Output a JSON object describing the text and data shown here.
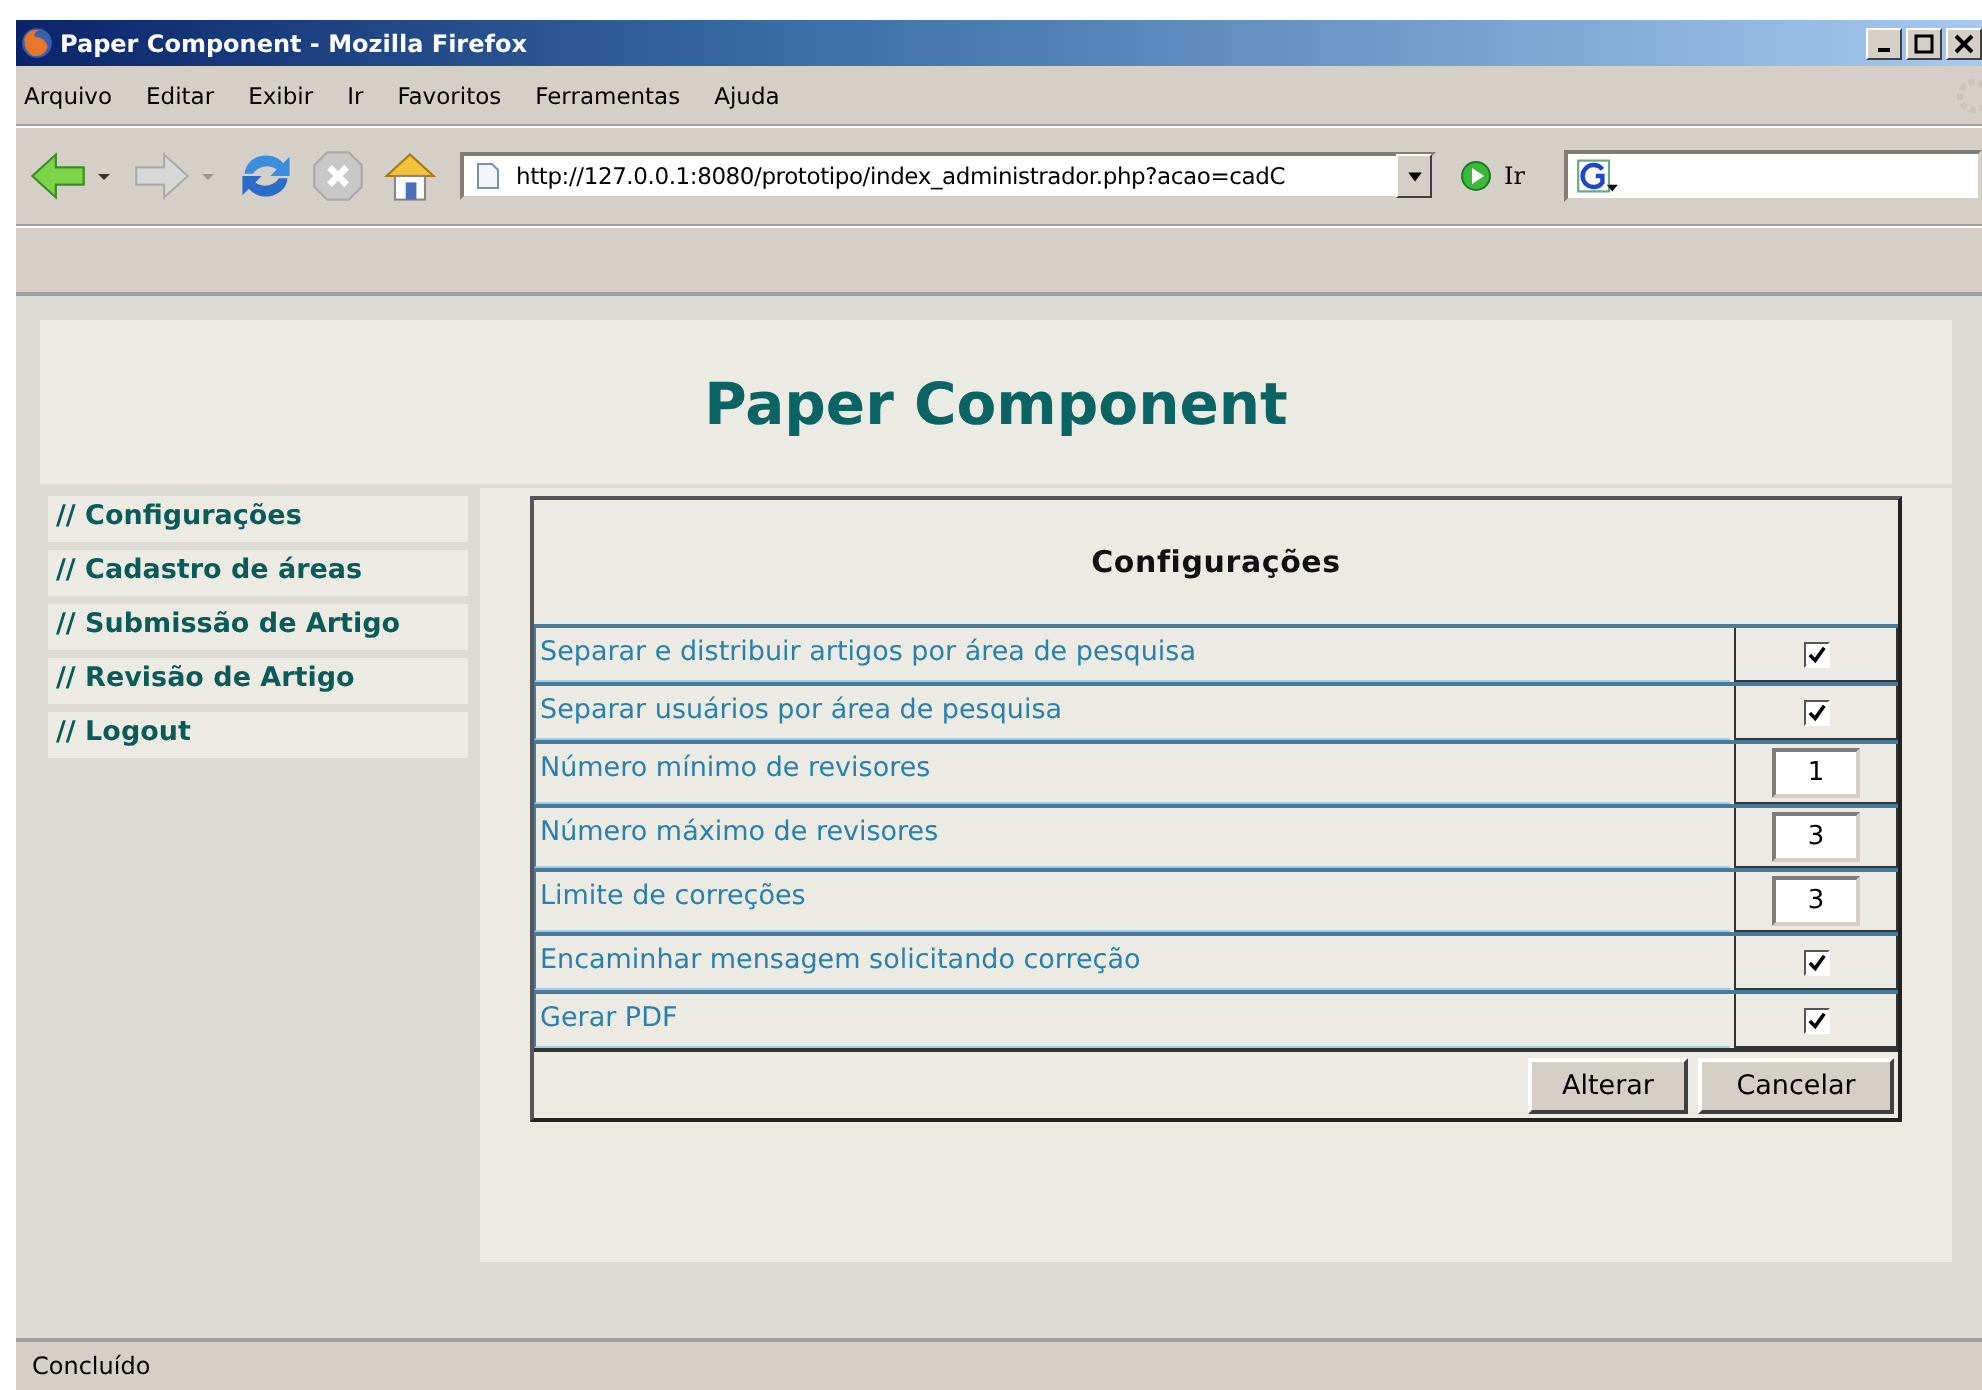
{
  "window": {
    "title": "Paper Component - Mozilla Firefox"
  },
  "menu": [
    "Arquivo",
    "Editar",
    "Exibir",
    "Ir",
    "Favoritos",
    "Ferramentas",
    "Ajuda"
  ],
  "address": {
    "value": "http://127.0.0.1:8080/prototipo/index_administrador.php?acao=cadC"
  },
  "go_label": "Ir",
  "page": {
    "title": "Paper Component",
    "sidebar": {
      "items": [
        "// Configurações",
        "// Cadastro de áreas",
        "// Submissão de Artigo",
        "// Revisão de Artigo",
        "// Logout"
      ]
    },
    "form": {
      "title": "Configurações",
      "rows": [
        {
          "label": "Separar e distribuir artigos por área de pesquisa",
          "kind": "checkbox",
          "checked": true
        },
        {
          "label": "Separar usuários por área de pesquisa",
          "kind": "checkbox",
          "checked": true
        },
        {
          "label": "Número mínimo de revisores",
          "kind": "number",
          "value": "1"
        },
        {
          "label": "Número máximo de revisores",
          "kind": "number",
          "value": "3"
        },
        {
          "label": "Limite de correções",
          "kind": "number",
          "value": "3"
        },
        {
          "label": "Encaminhar mensagem solicitando correção",
          "kind": "checkbox",
          "checked": true
        },
        {
          "label": "Gerar PDF",
          "kind": "checkbox",
          "checked": true
        }
      ],
      "buttons": [
        "Alterar",
        "Cancelar"
      ]
    }
  },
  "status_bar": "Concluído"
}
